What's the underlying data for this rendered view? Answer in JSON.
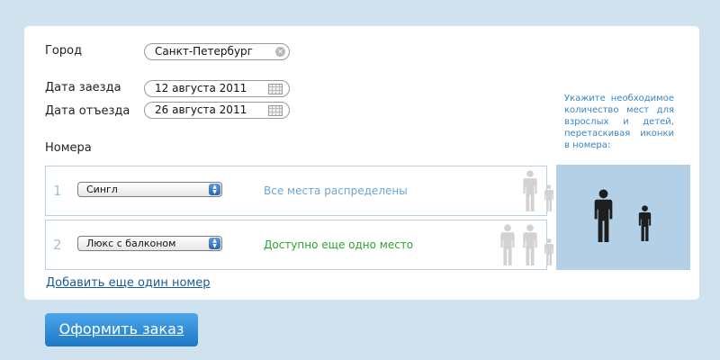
{
  "form": {
    "city_label": "Город",
    "city_value": "Санкт-Петербург",
    "checkin_label": "Дата заезда",
    "checkin_value": "12 августа 2011",
    "checkout_label": "Дата отъезда",
    "checkout_value": "26 августа 2011",
    "rooms_label": "Номера"
  },
  "rooms": [
    {
      "number": "1",
      "type": "Сингл",
      "status": "Все места распределены",
      "status_color": "#6aa7d3",
      "adults": 1,
      "children": 1
    },
    {
      "number": "2",
      "type": "Люкс с балконом",
      "status": "Доступно еще одно место",
      "status_color": "#2aa52a",
      "adults": 2,
      "children": 1
    }
  ],
  "add_room_link": "Добавить еще один номер",
  "hint": "Укажите необходимое количество мест для взрослых и детей, перетаскивая иконки в номера:",
  "dropzone": {
    "adult_icon": "adult-person-icon",
    "child_icon": "child-person-icon"
  },
  "order_button": "Оформить заказ",
  "colors": {
    "accent": "#1d78c6",
    "link": "#1a5b8f",
    "dropzone": "#b4d0e6"
  }
}
